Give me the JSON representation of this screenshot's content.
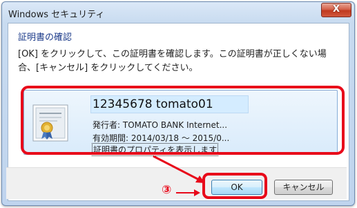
{
  "window": {
    "title": "Windows セキュリティ",
    "close_glyph": "X"
  },
  "dialog": {
    "heading": "証明書の確認",
    "message": "[OK] をクリックして、この証明書を確認します。この証明書が正しくない場合、[キャンセル] をクリックしてください。"
  },
  "certificate": {
    "icon": "certificate-icon",
    "name": "12345678 tomato01",
    "issuer": "発行者: TOMATO BANK Internet...",
    "validity": "有効期間: 2014/03/18 ～ 2015/0...",
    "properties_link": "証明書のプロパティを表示します"
  },
  "buttons": {
    "ok": "OK",
    "cancel": "キャンセル"
  },
  "annotation": {
    "step_label": "③",
    "color": "#e8091a"
  }
}
